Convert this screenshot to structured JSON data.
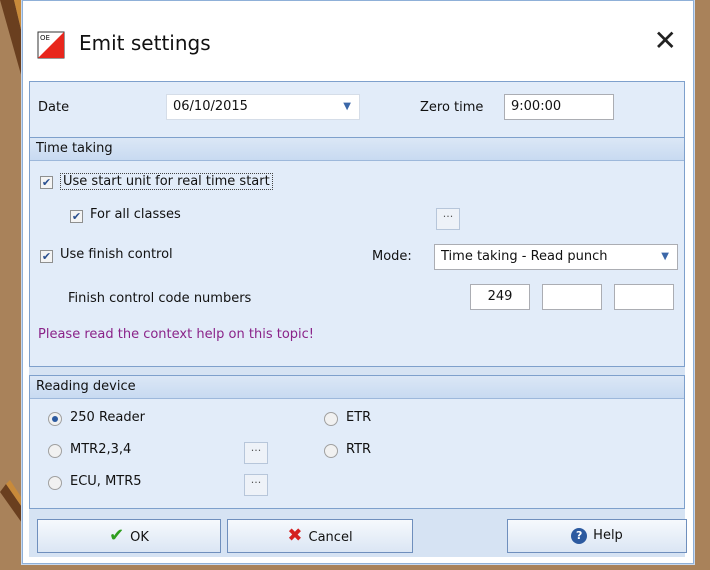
{
  "window": {
    "title": "Emit settings",
    "close_icon": "close-icon"
  },
  "top": {
    "date_label": "Date",
    "date_value": "06/10/2015",
    "zero_time_label": "Zero time",
    "zero_time_value": "9:00:00"
  },
  "time_taking": {
    "header": "Time taking",
    "use_start_unit_label": "Use start unit for real time start",
    "for_all_classes_label": "For all classes",
    "use_finish_control_label": "Use finish control",
    "mode_label": "Mode:",
    "mode_value": "Time taking - Read punch",
    "finish_codes_label": "Finish control code numbers",
    "finish_codes": [
      "249",
      "",
      ""
    ],
    "help_note": "Please read the context help on this topic!"
  },
  "reading_device": {
    "header": "Reading device",
    "options": [
      "250 Reader",
      "MTR2,3,4",
      "ECU, MTR5",
      "ETR",
      "RTR"
    ],
    "selected": "250 Reader"
  },
  "buttons": {
    "ok": "OK",
    "cancel": "Cancel",
    "help": "Help"
  },
  "colors": {
    "accent": "#2c5aa0",
    "help_note": "#8a2389",
    "ok_icon": "#2e9e1f",
    "cancel_icon": "#d42020"
  }
}
